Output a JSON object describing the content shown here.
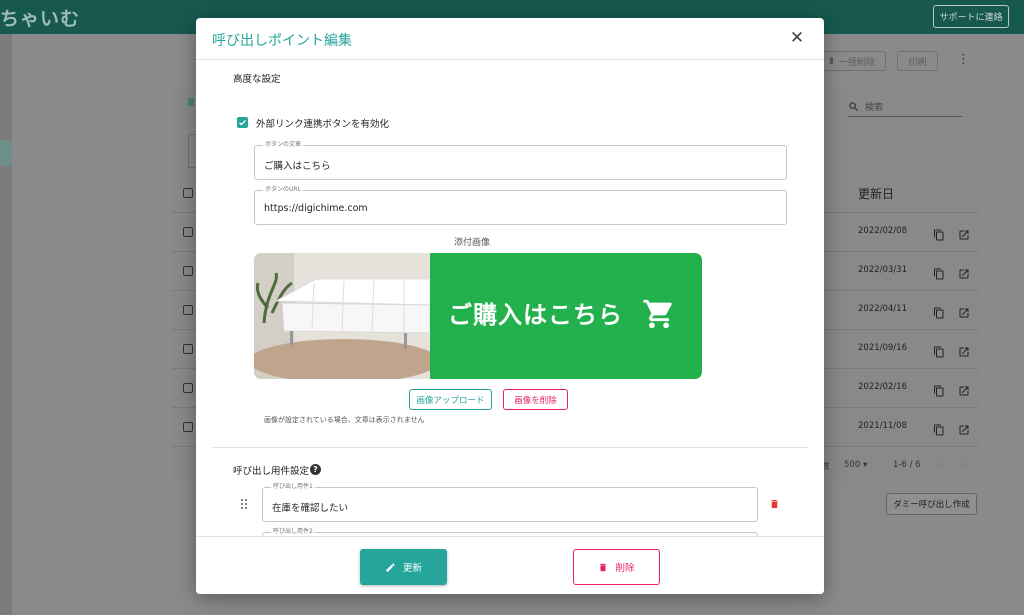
{
  "app": {
    "logo": "ちゃいむ",
    "support_button": "サポートに連絡"
  },
  "background": {
    "bulk_delete_button": "一括削除",
    "print_button": "印刷",
    "search_placeholder": "検索",
    "updated_column": "更新日",
    "rows": [
      {
        "date": "2022/02/08"
      },
      {
        "date": "2022/03/31"
      },
      {
        "date": "2022/04/11"
      },
      {
        "date": "2021/09/16"
      },
      {
        "date": "2022/02/16"
      },
      {
        "date": "2021/11/08"
      }
    ],
    "pager": {
      "rows_label": "数",
      "per_page": "500",
      "range": "1-6 / 6"
    },
    "dummy_button": "ダミー呼び出し作成"
  },
  "dialog": {
    "title": "呼び出しポイント編集",
    "advanced_title": "高度な設定",
    "external_link_checkbox": {
      "label": "外部リンク連携ボタンを有効化",
      "checked": true
    },
    "button_text_field": {
      "label": "ボタンの文章",
      "value": "ご購入はこちら"
    },
    "button_url_field": {
      "label": "ボタンのURL",
      "value": "https://digichime.com"
    },
    "attached_image_label": "添付画像",
    "attached_image_text": "ご購入はこちら",
    "upload_button": "画像アップロード",
    "delete_image_button": "画像を削除",
    "image_note": "画像が設定されている場合、文章は表示されません",
    "call_settings_title": "呼び出し用件設定",
    "call_items": [
      {
        "label": "呼び出し用件1",
        "value": "在庫を確認したい"
      },
      {
        "label": "呼び出し用件2",
        "value": ""
      }
    ],
    "update_button": "更新",
    "delete_button": "削除"
  },
  "colors": {
    "accent": "#26a69a",
    "danger": "#e91e63",
    "header": "#17594f",
    "image_green": "#22b14c"
  }
}
